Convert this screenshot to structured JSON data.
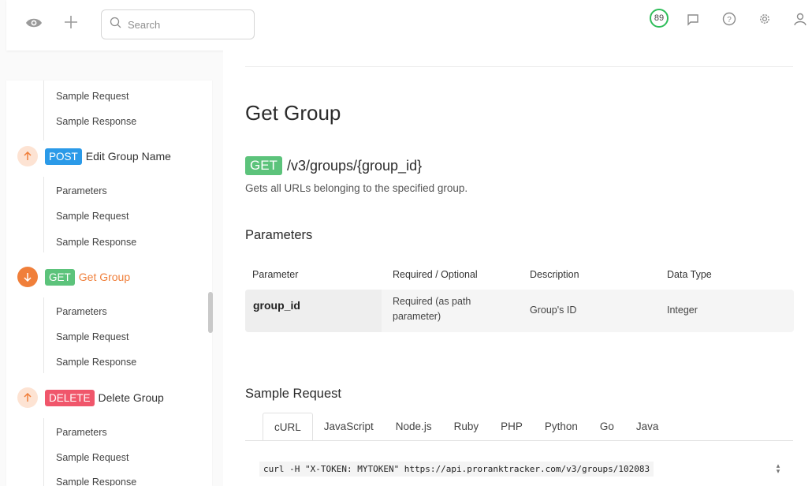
{
  "topbar": {
    "search_placeholder": "Search",
    "score": "89",
    "icons": [
      "eye-icon",
      "plus-icon",
      "search-icon",
      "score-badge",
      "chat-icon",
      "help-icon",
      "gear-icon",
      "user-icon"
    ]
  },
  "sidebar": {
    "sections": [
      {
        "subitems": [
          "Sample Request",
          "Sample Response"
        ]
      },
      {
        "method": "POST",
        "name": "Edit Group Name",
        "subitems": [
          "Parameters",
          "Sample Request",
          "Sample Response"
        ]
      },
      {
        "method": "GET",
        "name": "Get Group",
        "active": true,
        "subitems": [
          "Parameters",
          "Sample Request",
          "Sample Response"
        ]
      },
      {
        "method": "DELETE",
        "name": "Delete Group",
        "subitems": [
          "Parameters",
          "Sample Request",
          "Sample Response"
        ]
      }
    ]
  },
  "main": {
    "title": "Get Group",
    "method": "GET",
    "path": "/v3/groups/{group_id}",
    "description": "Gets all URLs belonging to the specified group.",
    "parameters_title": "Parameters",
    "table": {
      "headers": [
        "Parameter",
        "Required / Optional",
        "Description",
        "Data Type"
      ],
      "rows": [
        {
          "name": "group_id",
          "required_line1": "Required (as path",
          "required_line2": "parameter)",
          "description": "Group's ID",
          "type": "Integer"
        }
      ]
    },
    "sample_request_title": "Sample Request",
    "tabs": [
      "cURL",
      "JavaScript",
      "Node.js",
      "Ruby",
      "PHP",
      "Python",
      "Go",
      "Java"
    ],
    "active_tab": "cURL",
    "code": "curl -H \"X-TOKEN: MYTOKEN\" https://api.proranktracker.com/v3/groups/102083"
  },
  "colors": {
    "get": "#5cc37b",
    "post": "#2b9ae8",
    "delete": "#f0566b",
    "active": "#f07f3a",
    "score_ring": "#2ebd59"
  }
}
